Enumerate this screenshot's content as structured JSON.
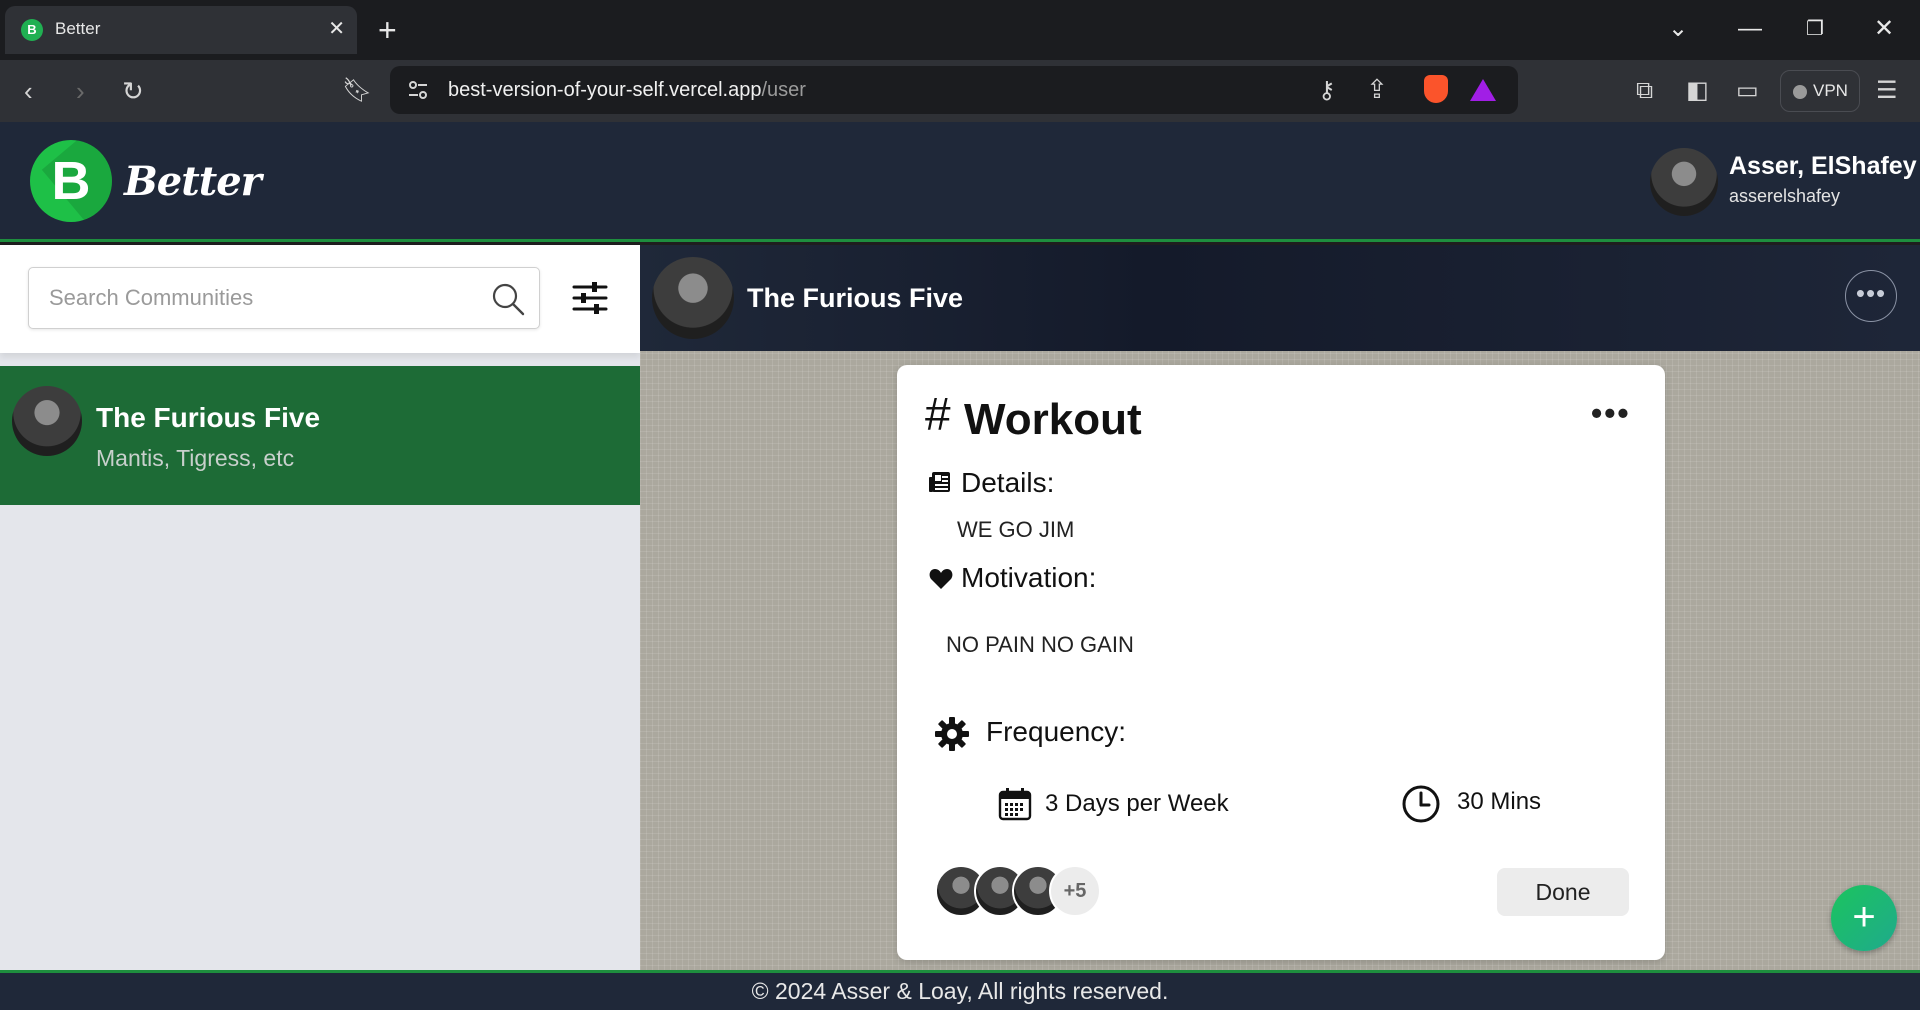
{
  "browser": {
    "tab_title": "Better",
    "tab_favicon_letter": "B",
    "url_host": "best-version-of-your-self.vercel.app",
    "url_path": "/user",
    "vpn_label": "VPN"
  },
  "header": {
    "logo_letter": "B",
    "logo_word": "Better",
    "user_name": "Asser, ElShafey",
    "user_handle": "asserelshafey"
  },
  "sidebar": {
    "search_placeholder": "Search Communities",
    "communities": [
      {
        "name": "The Furious Five",
        "members": "Mantis, Tigress, etc"
      }
    ]
  },
  "chat": {
    "title": "The Furious Five",
    "more_label": "•••"
  },
  "card": {
    "hash": "#",
    "title": "Workout",
    "more_label": "•••",
    "details_label": "Details:",
    "details_value": "WE GO JIM",
    "motivation_label": "Motivation:",
    "motivation_value": "NO PAIN NO GAIN",
    "frequency_label": "Frequency:",
    "frequency_days": "3 Days per Week",
    "frequency_duration": "30 Mins",
    "extra_members": "+5",
    "done_label": "Done"
  },
  "fab_label": "+",
  "footer": {
    "text": "© 2024 Asser & Loay, All rights reserved."
  },
  "colors": {
    "header_bg": "#1f2839",
    "accent_green": "#1e8e3e",
    "active_item": "#1d6b36",
    "logo_green": "#1ec047"
  }
}
